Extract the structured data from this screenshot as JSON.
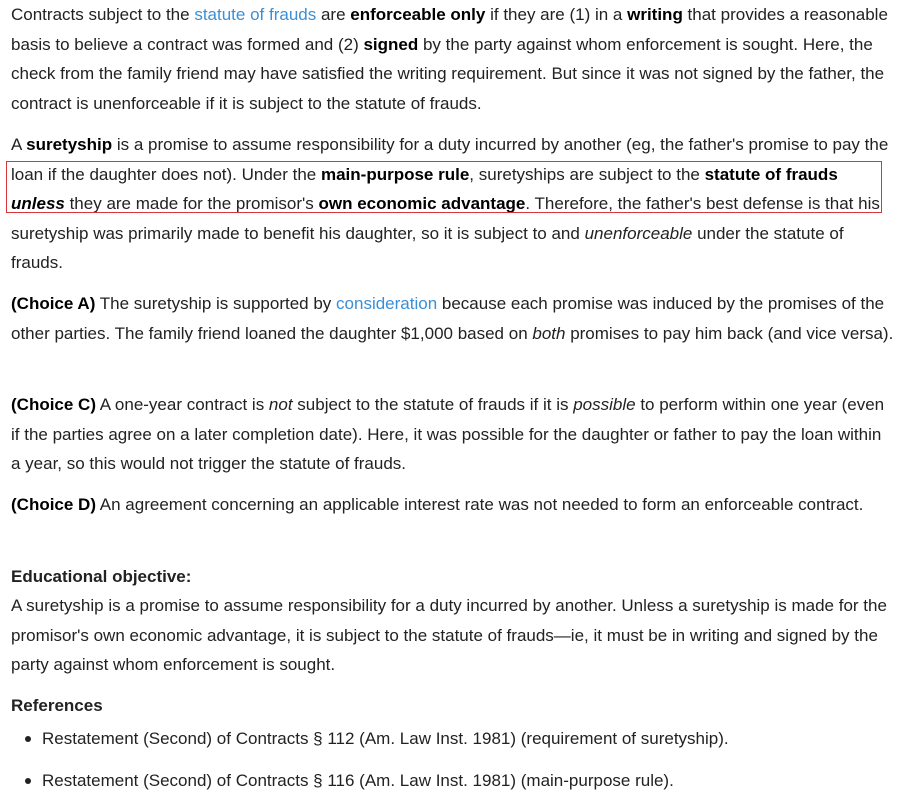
{
  "p1": {
    "t1": "Contracts subject to the ",
    "link1": "statute of frauds",
    "t2": " are ",
    "b1": "enforceable only",
    "t3": " if they are (1) in a ",
    "b2": "writing",
    "t4": " that provides a reasonable basis to believe a contract was formed and (2) ",
    "b3": "signed",
    "t5": " by the party against whom enforcement is sought.  Here, the check from the family friend may have satisfied the writing requirement.  But since it was not signed by the father, the contract is unenforceable if it is subject to the statute of frauds."
  },
  "p2": {
    "t1": "A ",
    "b1": "suretyship",
    "t2": " is a promise to assume responsibility for a duty incurred by another (eg, the father's promise to pay the loan if the daughter does not).  Under the ",
    "b2": "main-purpose rule",
    "t3": ", suretyships are subject to the ",
    "b3": "statute of frauds ",
    "bi1": "unless",
    "t4": " they are made for the promisor's ",
    "b4": "own economic advantage",
    "t5": ".  Therefore, the father's best defense is that his suretyship was primarily made to benefit his daughter, so it is subject to and ",
    "i1": "unenforceable",
    "t6": " under the statute of frauds."
  },
  "p3": {
    "label": "(Choice A)",
    "t1": "  The suretyship is supported by ",
    "link1": "consideration",
    "t2": " because each promise was induced by the promises of the other parties.  The family friend loaned the daughter $1,000 based on ",
    "i1": "both",
    "t3": " promises to pay him back (and vice versa)."
  },
  "p4": {
    "label": "(Choice C)",
    "t1": "  A one-year contract is ",
    "i1": "not",
    "t2": " subject to the statute of frauds if it is ",
    "i2": "possible",
    "t3": " to perform within one year (even if the parties agree on a later completion date).  Here, it was possible for the daughter or father to pay the loan within a year, so this would not trigger the statute of frauds."
  },
  "p5": {
    "label": "(Choice D)",
    "t1": "  An agreement concerning an applicable interest rate was not needed to form an enforceable contract."
  },
  "educational": {
    "title": "Educational objective:",
    "body": "A suretyship is a promise to assume responsibility for a duty incurred by another.  Unless a suretyship is made for the promisor's own economic advantage, it is subject to the statute of frauds—ie, it must be in writing and signed by the party against whom enforcement is sought."
  },
  "references": {
    "title": "References",
    "items": [
      "Restatement (Second) of Contracts § 112 (Am. Law Inst. 1981) (requirement of suretyship).",
      "Restatement (Second) of Contracts § 116 (Am. Law Inst. 1981) (main-purpose rule)."
    ]
  },
  "colors": {
    "link": "#3a8fd6",
    "highlight_border": "#d9363a",
    "text": "#222222"
  }
}
